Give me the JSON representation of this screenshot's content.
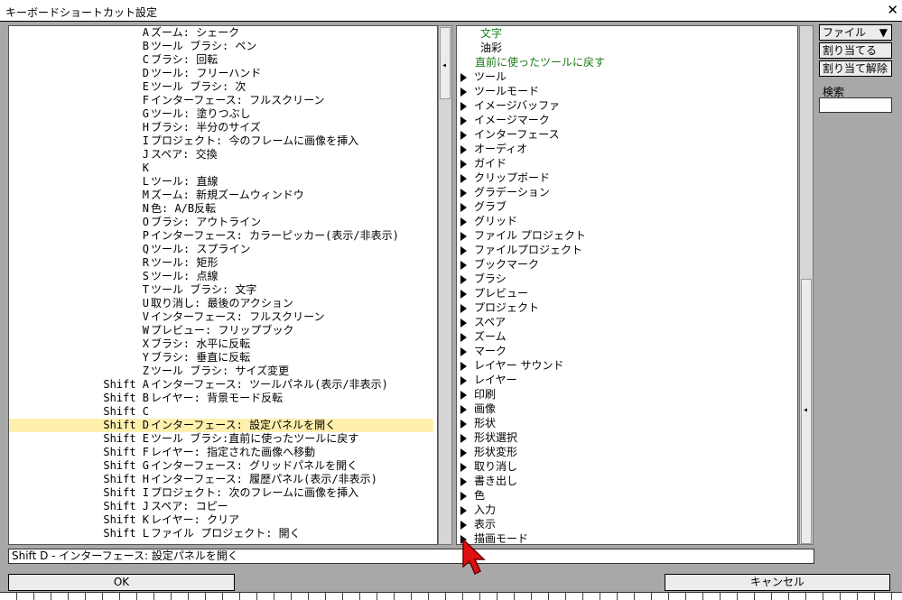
{
  "window": {
    "title": "キーボードショートカット設定",
    "close_label": "✕"
  },
  "shortcuts": [
    {
      "key": "A",
      "action": "ズーム: シェーク"
    },
    {
      "key": "B",
      "action": "ツール ブラシ: ペン"
    },
    {
      "key": "C",
      "action": "ブラシ: 回転"
    },
    {
      "key": "D",
      "action": "ツール: フリーハンド"
    },
    {
      "key": "E",
      "action": "ツール ブラシ: 次"
    },
    {
      "key": "F",
      "action": "インターフェース: フルスクリーン"
    },
    {
      "key": "G",
      "action": "ツール: 塗りつぶし"
    },
    {
      "key": "H",
      "action": "ブラシ: 半分のサイズ"
    },
    {
      "key": "I",
      "action": "プロジェクト: 今のフレームに画像を挿入"
    },
    {
      "key": "J",
      "action": "スペア: 交換"
    },
    {
      "key": "K",
      "action": ""
    },
    {
      "key": "L",
      "action": "ツール: 直線"
    },
    {
      "key": "M",
      "action": "ズーム: 新規ズームウィンドウ"
    },
    {
      "key": "N",
      "action": "色: A/B反転"
    },
    {
      "key": "O",
      "action": "ブラシ: アウトライン"
    },
    {
      "key": "P",
      "action": "インターフェース: カラーピッカー(表示/非表示)"
    },
    {
      "key": "Q",
      "action": "ツール: スプライン"
    },
    {
      "key": "R",
      "action": "ツール: 矩形"
    },
    {
      "key": "S",
      "action": "ツール: 点線"
    },
    {
      "key": "T",
      "action": "ツール ブラシ: 文字"
    },
    {
      "key": "U",
      "action": "取り消し: 最後のアクション"
    },
    {
      "key": "V",
      "action": "インターフェース: フルスクリーン"
    },
    {
      "key": "W",
      "action": "プレビュー: フリップブック"
    },
    {
      "key": "X",
      "action": "ブラシ: 水平に反転"
    },
    {
      "key": "Y",
      "action": "ブラシ: 垂直に反転"
    },
    {
      "key": "Z",
      "action": "ツール ブラシ: サイズ変更"
    },
    {
      "key": "Shift A",
      "action": "インターフェース: ツールパネル(表示/非表示)"
    },
    {
      "key": "Shift B",
      "action": "レイヤー: 背景モード反転"
    },
    {
      "key": "Shift C",
      "action": ""
    },
    {
      "key": "Shift D",
      "action": "インターフェース: 設定パネルを開く"
    },
    {
      "key": "Shift E",
      "action": "ツール ブラシ:直前に使ったツールに戻す"
    },
    {
      "key": "Shift F",
      "action": "レイヤー: 指定された画像へ移動"
    },
    {
      "key": "Shift G",
      "action": "インターフェース: グリッドパネルを開く"
    },
    {
      "key": "Shift H",
      "action": "インターフェース: 履歴パネル(表示/非表示)"
    },
    {
      "key": "Shift I",
      "action": "プロジェクト: 次のフレームに画像を挿入"
    },
    {
      "key": "Shift J",
      "action": "スペア: コピー"
    },
    {
      "key": "Shift K",
      "action": "レイヤー: クリア"
    },
    {
      "key": "Shift L",
      "action": "ファイル プロジェクト: 開く"
    }
  ],
  "selected_index": 29,
  "tree_top": [
    {
      "label": "文字",
      "color": "green",
      "indent": 26
    },
    {
      "label": "油彩",
      "color": "black",
      "indent": 26
    },
    {
      "label": "直前に使ったツールに戻す",
      "color": "green",
      "indent": 20
    }
  ],
  "tree": [
    "ツール",
    "ツールモード",
    "イメージバッファ",
    "イメージマーク",
    "インターフェース",
    "オーディオ",
    "ガイド",
    "クリップボード",
    "グラデーション",
    "グラブ",
    "グリッド",
    "ファイル プロジェクト",
    "ファイルプロジェクト",
    "ブックマーク",
    "ブラシ",
    "プレビュー",
    "プロジェクト",
    "スペア",
    "ズーム",
    "マーク",
    "レイヤー サウンド",
    "レイヤー",
    "印刷",
    "画像",
    "形状",
    "形状選択",
    "形状変形",
    "取り消し",
    "書き出し",
    "色",
    "入力",
    "表示",
    "描画モード"
  ],
  "status_text": "Shift D - インターフェース: 設定パネルを開く",
  "side": {
    "file_label": "ファイル",
    "assign_label": "割り当てる",
    "unassign_label": "割り当て解除",
    "search_label": "検索",
    "search_value": ""
  },
  "buttons": {
    "ok": "OK",
    "cancel": "キャンセル"
  },
  "colors": {
    "selection": "#fff0ae",
    "green_text": "#1b7a1b",
    "cursor": "#e01010"
  }
}
